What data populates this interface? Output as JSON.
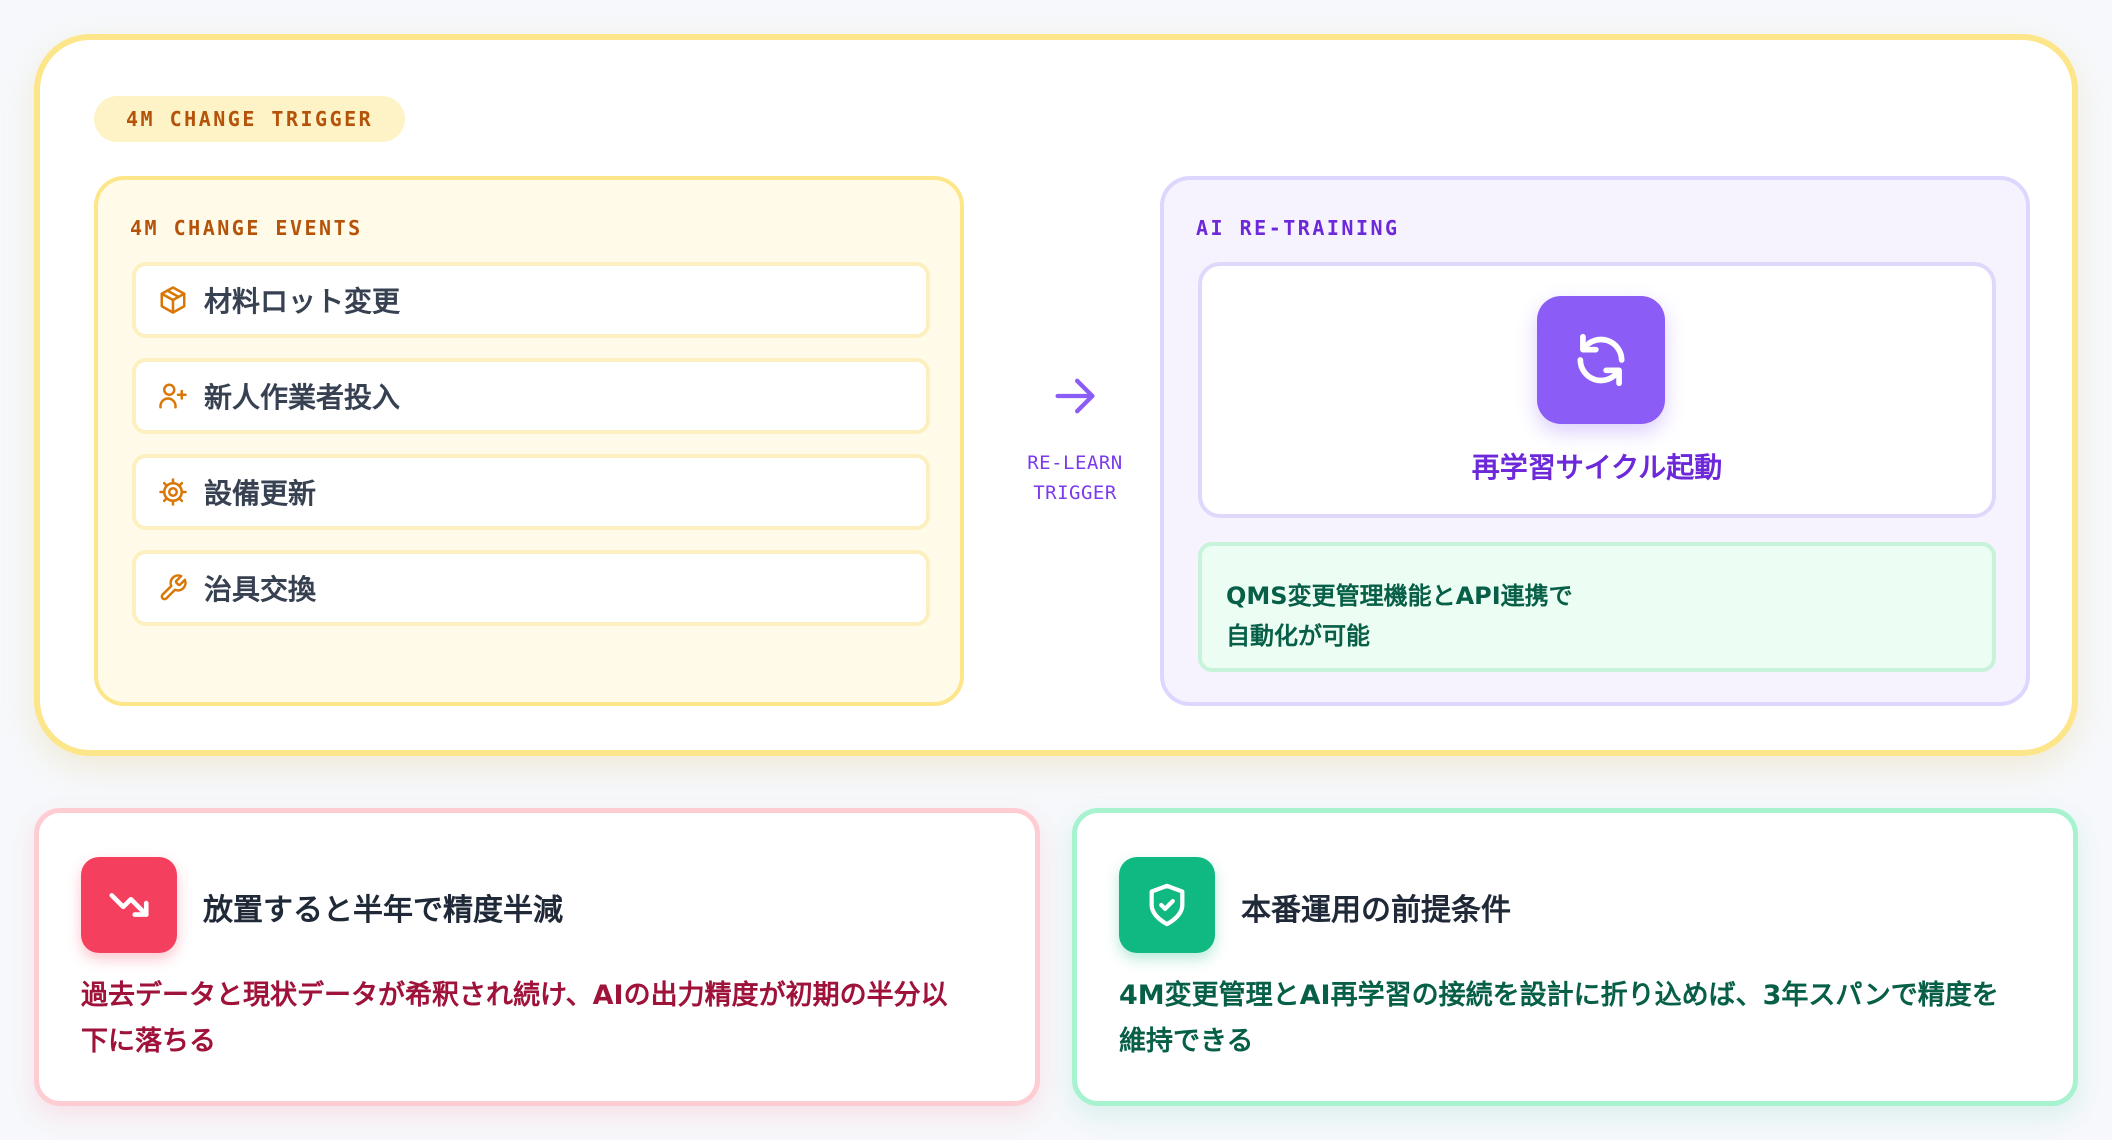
{
  "trigger_section": {
    "badge": "4M CHANGE TRIGGER",
    "events_panel": {
      "title": "4M CHANGE EVENTS",
      "items": [
        {
          "label": "材料ロット変更",
          "icon": "package-icon"
        },
        {
          "label": "新人作業者投入",
          "icon": "user-plus-icon"
        },
        {
          "label": "設備更新",
          "icon": "settings-gear-icon"
        },
        {
          "label": "治具交換",
          "icon": "wrench-icon"
        }
      ]
    },
    "connector": {
      "icon": "arrow-right-icon",
      "line1": "RE-LEARN",
      "line2": "TRIGGER"
    },
    "ai_panel": {
      "title": "AI RE-TRAINING",
      "cycle_icon": "refresh-cycle-icon",
      "cycle_label": "再学習サイクル起動",
      "note_line1": "QMS変更管理機能とAPI連携で",
      "note_line2": "自動化が可能"
    }
  },
  "cards": {
    "risk": {
      "icon": "trending-down-icon",
      "title": "放置すると半年で精度半減",
      "line1": "過去データと現状データが希釈され続け、AIの出力精度が初期の半分以",
      "line2": "下に落ちる"
    },
    "prereq": {
      "icon": "shield-check-icon",
      "title": "本番運用の前提条件",
      "line1": "4M変更管理とAI再学習の接続を設計に折り込めば、3年スパンで精度を",
      "line2": "維持できる"
    }
  },
  "colors": {
    "amber_border": "#fde68a",
    "amber_text": "#b45309",
    "violet_accent": "#8b5cf6",
    "violet_text": "#6d28d9",
    "green_text": "#065f46",
    "rose_accent": "#f43f5e",
    "rose_text": "#9f1239",
    "emerald_accent": "#10b981"
  }
}
